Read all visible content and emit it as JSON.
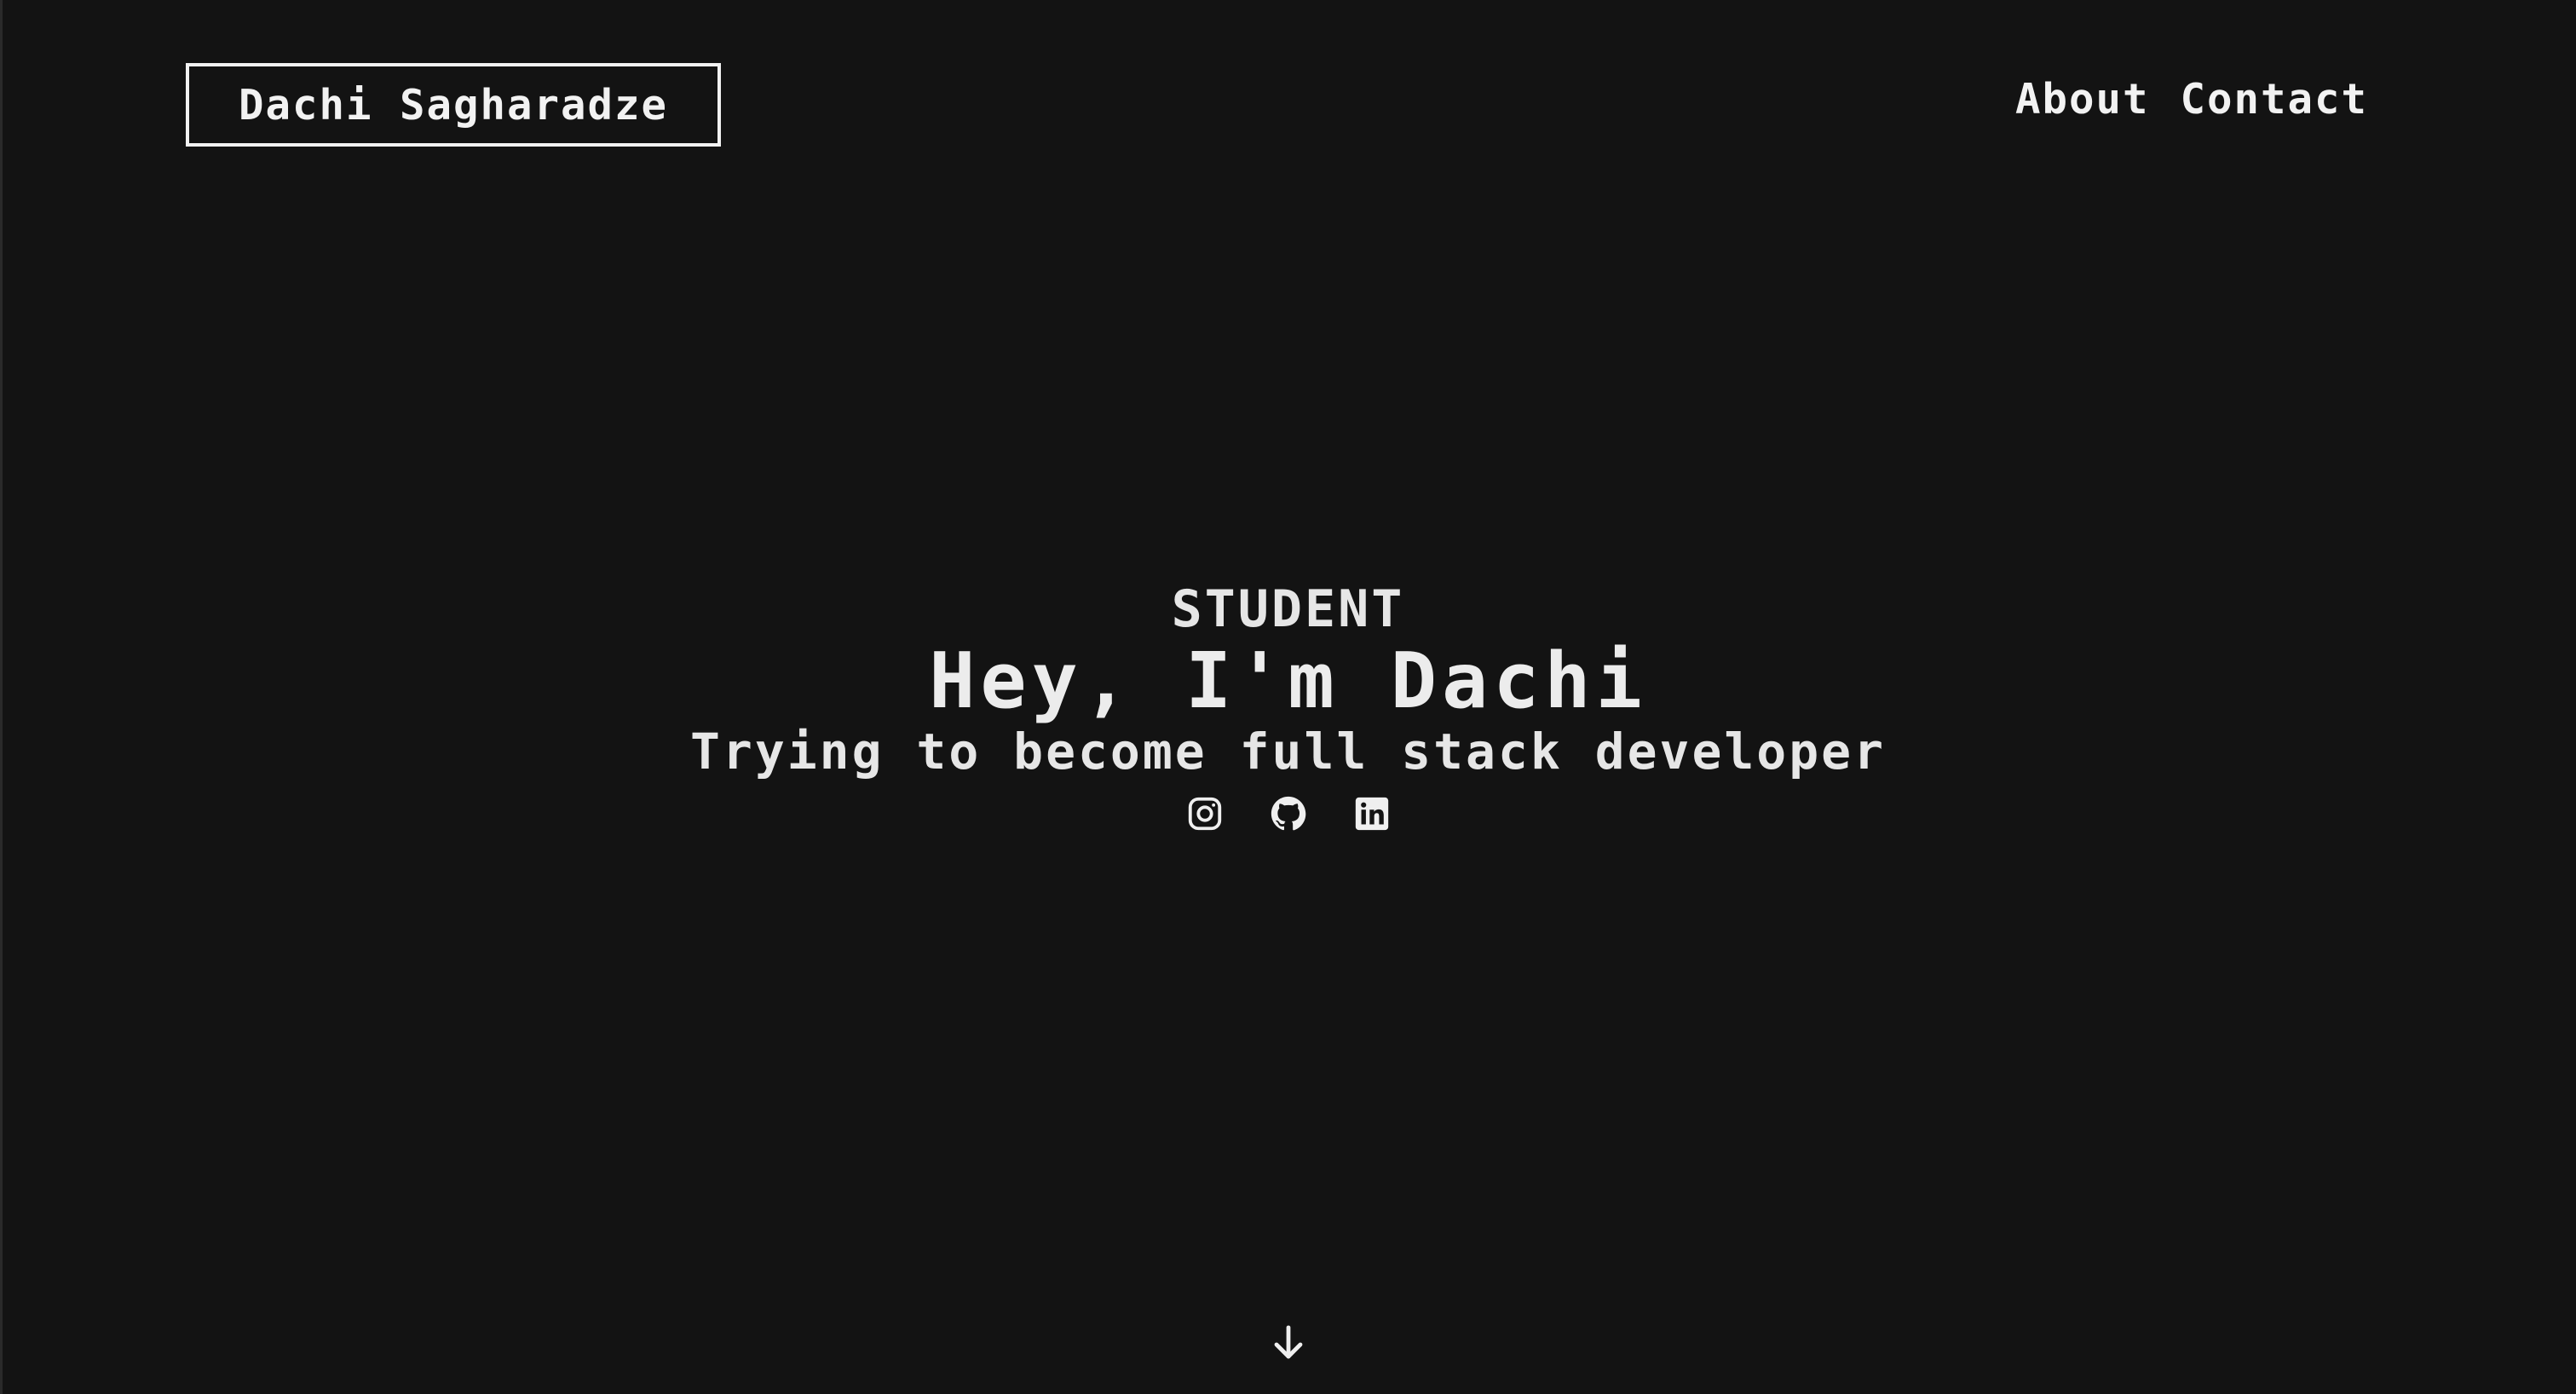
{
  "header": {
    "logo_text": "Dachi Sagharadze",
    "nav": [
      {
        "label": "About"
      },
      {
        "label": "Contact"
      }
    ]
  },
  "hero": {
    "eyebrow": "STUDENT",
    "headline": "Hey, I'm Dachi",
    "subline": "Trying to become full stack developer",
    "socials": [
      {
        "icon": "instagram-icon"
      },
      {
        "icon": "github-icon"
      },
      {
        "icon": "linkedin-icon"
      }
    ]
  },
  "scroll_hint": {
    "icon": "arrow-down-icon"
  },
  "colors": {
    "background": "#131313",
    "text": "#efefef"
  }
}
